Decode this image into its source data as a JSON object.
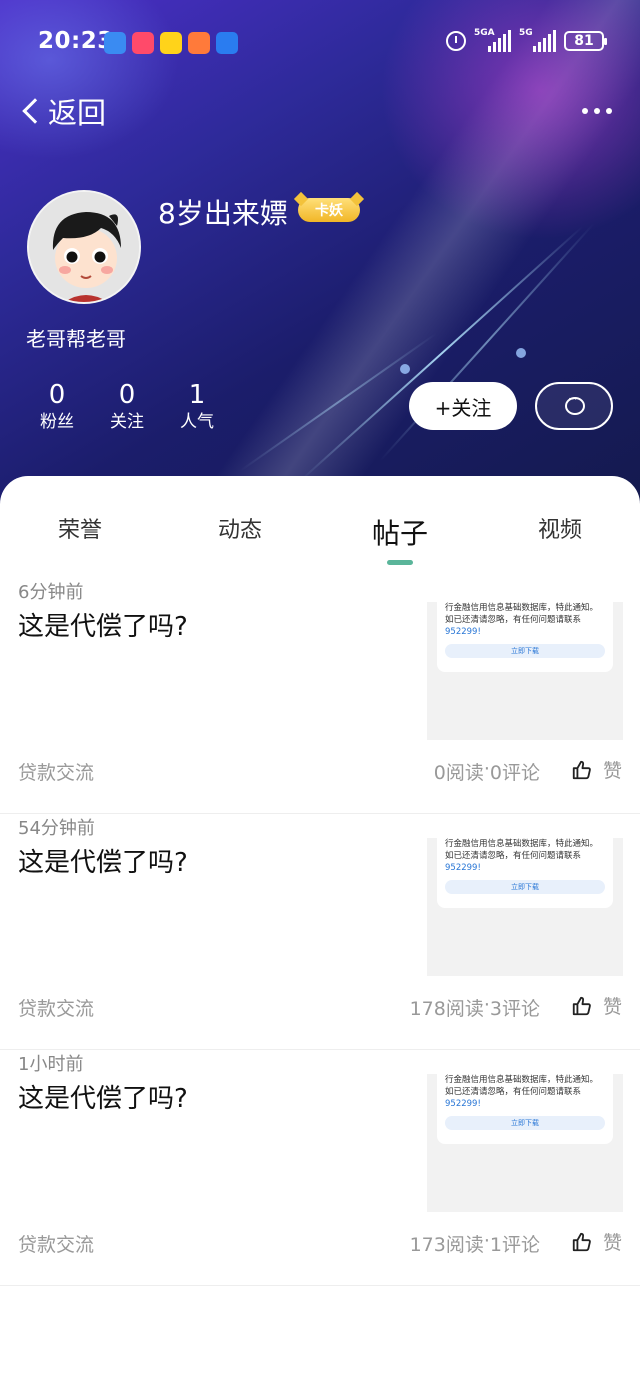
{
  "status_bar": {
    "time": "20:23",
    "signal1": "5GA",
    "signal2": "5G",
    "battery": "81",
    "app_icon_colors": [
      "#3a8bf2",
      "#ff4a6a",
      "#ffd31a",
      "#ff7a3a",
      "#2a7cf0"
    ]
  },
  "nav": {
    "back_label": "返回"
  },
  "profile": {
    "username": "8岁出来嫖",
    "badge": "卡妖",
    "signature": "老哥帮老哥",
    "stats": [
      {
        "num": "0",
        "label": "粉丝"
      },
      {
        "num": "0",
        "label": "关注"
      },
      {
        "num": "1",
        "label": "人气"
      }
    ],
    "follow_label": "+关注"
  },
  "tabs": [
    {
      "label": "荣誉",
      "active": false
    },
    {
      "label": "动态",
      "active": false
    },
    {
      "label": "帖子",
      "active": true
    },
    {
      "label": "视频",
      "active": false
    }
  ],
  "posts": [
    {
      "time": "6分钟前",
      "title": "这是代偿了吗?",
      "category": "贷款交流",
      "reads": "0阅读",
      "comments": "0评论",
      "like_label": "赞",
      "thumb": {
        "line1": "行金融信用信息基础数据库，特此通知。",
        "line2": "如已还清请忽略，有任何问题请联系",
        "phone": "952299!",
        "button": "立即下载"
      }
    },
    {
      "time": "54分钟前",
      "title": "这是代偿了吗?",
      "category": "贷款交流",
      "reads": "178阅读",
      "comments": "3评论",
      "like_label": "赞",
      "thumb": {
        "line1": "行金融信用信息基础数据库，特此通知。",
        "line2": "如已还清请忽略，有任何问题请联系",
        "phone": "952299!",
        "button": "立即下载"
      }
    },
    {
      "time": "1小时前",
      "title": "这是代偿了吗?",
      "category": "贷款交流",
      "reads": "173阅读",
      "comments": "1评论",
      "like_label": "赞",
      "thumb": {
        "line1": "行金融信用信息基础数据库，特此通知。",
        "line2": "如已还清请忽略，有任何问题请联系",
        "phone": "952299!",
        "button": "立即下载"
      }
    }
  ],
  "meta_separator": "·"
}
